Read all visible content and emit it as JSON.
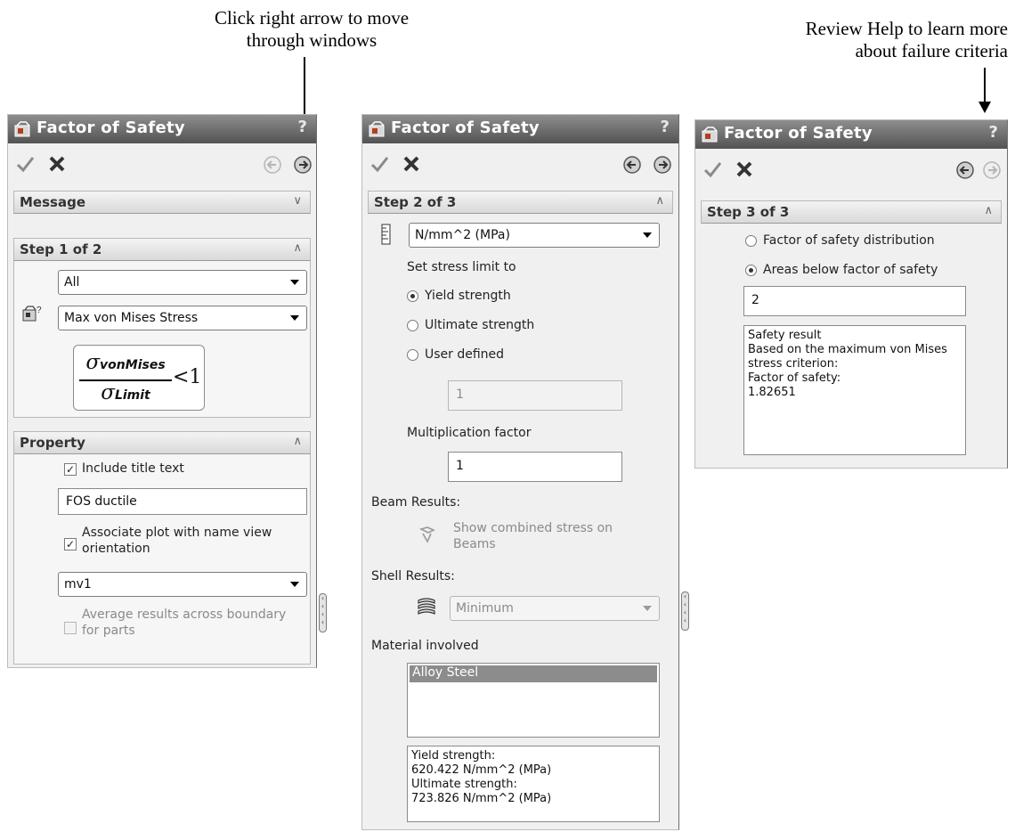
{
  "annotations": {
    "left_line1": "Click right arrow to move",
    "left_line2": "through windows",
    "right_line1": "Review Help to learn more",
    "right_line2": "about failure criteria"
  },
  "panels": [
    {
      "title": "Factor of Safety",
      "help": "?",
      "message_section": "Message",
      "step_section": "Step 1 of 2",
      "component_dropdown": "All",
      "criterion_dropdown": "Max von Mises Stress",
      "formula": {
        "num_sym": "σ",
        "num_sub": "vonMises",
        "den_sym": "σ",
        "den_sub": "Limit",
        "rel": "<1"
      },
      "property_section": "Property",
      "include_title_label": "Include title text",
      "title_text_value": "FOS ductile",
      "associate_label_line1": "Associate plot with name view",
      "associate_label_line2": "orientation",
      "view_dropdown": "mv1",
      "average_label_line1": "Average results across boundary",
      "average_label_line2": "for parts"
    },
    {
      "title": "Factor of Safety",
      "help": "?",
      "step_section": "Step 2 of 3",
      "units_dropdown": "N/mm^2 (MPa)",
      "set_limit_label": "Set stress limit to",
      "opt_yield": "Yield strength",
      "opt_ultimate": "Ultimate strength",
      "opt_user": "User defined",
      "user_value": "1",
      "mult_label": "Multiplication factor",
      "mult_value": "1",
      "beam_label": "Beam Results:",
      "beam_check_line1": "Show combined stress on",
      "beam_check_line2": "Beams",
      "shell_label": "Shell Results:",
      "shell_dropdown": "Minimum",
      "material_label": "Material involved",
      "material_selected": "Alloy Steel",
      "material_info": "Yield strength:\n620.422 N/mm^2 (MPa)\nUltimate strength:\n723.826 N/mm^2 (MPa)"
    },
    {
      "title": "Factor of Safety",
      "help": "?",
      "step_section": "Step 3 of 3",
      "opt_distribution": "Factor of safety distribution",
      "opt_areas_below": "Areas below factor of safety",
      "fos_value": "2",
      "result_text": "Safety result\nBased on the maximum von Mises\nstress criterion:\nFactor of safety:\n1.82651"
    }
  ]
}
